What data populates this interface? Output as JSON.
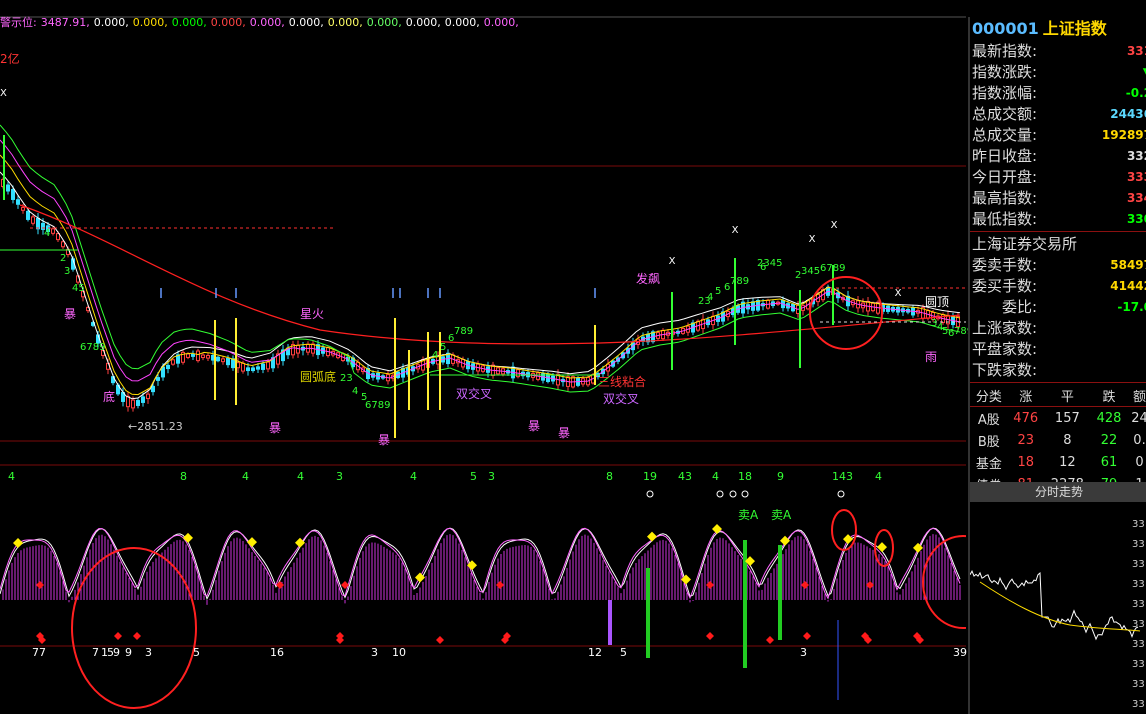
{
  "topbar": {
    "label": "警示位:",
    "values": [
      "3487.91,",
      "0.000,",
      "0.000,",
      "0.000,",
      "0.000,",
      "0.000,",
      "0.000,",
      "0.000,",
      "0.000,",
      "0.000,",
      "0.000,",
      "0.000,"
    ],
    "colors": [
      "#ff66ff",
      "#ffffff",
      "#ffdd00",
      "#00ff00",
      "#ff4444",
      "#ff66ff",
      "#ffffff",
      "#ffff66",
      "#66ff66",
      "#ffffff",
      "#ffffff",
      "#ff66ff"
    ]
  },
  "chart": {
    "left_tag": "2亿",
    "x_marker": "X",
    "low_label": "←2851.23",
    "annotations": {
      "xinghuo": "星火",
      "yuanhudi": "圆弧底",
      "shuangjiaocha1": "双交叉",
      "shuangjiaocha2": "双交叉",
      "sanxian": "三线粘合",
      "fapiao": "发飙",
      "yuanding": "圆顶",
      "yu": "雨",
      "bao1": "暴",
      "bao2": "暴",
      "bao3": "暴",
      "bao4": "暴",
      "bao5": "暴",
      "di": "底",
      "maiA1": "卖A",
      "maiA2": "卖A"
    },
    "seq_labels": [
      "4",
      "2",
      "3",
      "45",
      "6789",
      "23",
      "4",
      "5",
      "6789",
      "4",
      "5",
      "6",
      "789",
      "2345",
      "6",
      "23",
      "4",
      "5",
      "6",
      "789",
      "2",
      "345",
      "6789",
      "3",
      "4",
      "5",
      "6",
      "789"
    ],
    "osc_numbers": [
      "4",
      "8",
      "4",
      "4",
      "3",
      "4",
      "5",
      "3",
      "8",
      "19",
      "43",
      "4",
      "18",
      "9",
      "143",
      "4"
    ],
    "bottom_numbers": [
      "77",
      "7",
      "1",
      "5",
      "9",
      "9",
      "3",
      "5",
      "16",
      "3",
      "10",
      "12",
      "5",
      "3",
      "39"
    ]
  },
  "panel": {
    "code": "000001",
    "name": "上证指数",
    "rows": [
      {
        "label": "最新指数:",
        "value": "331",
        "color": "#ff4444"
      },
      {
        "label": "指数涨跌:",
        "value": "▼",
        "color": "#00ff00"
      },
      {
        "label": "指数涨幅:",
        "value": "-0.2",
        "color": "#00ff00"
      },
      {
        "label": "总成交额:",
        "value": "24436",
        "color": "#5bd8ff"
      },
      {
        "label": "总成交量:",
        "value": "192897",
        "color": "#ffd800"
      },
      {
        "label": "昨日收盘:",
        "value": "332",
        "color": "#dddddd"
      },
      {
        "label": "今日开盘:",
        "value": "333",
        "color": "#ff4444"
      },
      {
        "label": "最高指数:",
        "value": "334",
        "color": "#ff4444"
      },
      {
        "label": "最低指数:",
        "value": "330",
        "color": "#00ff00"
      }
    ],
    "exchange": "上海证券交易所",
    "rows2": [
      {
        "label": "委卖手数:",
        "value": "58497",
        "color": "#ffd800"
      },
      {
        "label": "委买手数:",
        "value": "41442",
        "color": "#ffd800"
      },
      {
        "label": "委比:",
        "value": "-17.0",
        "color": "#00ff00"
      },
      {
        "label": "上涨家数:",
        "value": "",
        "color": "#ff4444"
      },
      {
        "label": "平盘家数:",
        "value": "",
        "color": "#dddddd"
      },
      {
        "label": "下跌家数:",
        "value": "",
        "color": "#00ff00"
      }
    ],
    "table_headers": [
      "分类",
      "涨",
      "平",
      "跌",
      "额"
    ],
    "table_rows": [
      {
        "cat": "A股",
        "up": "476",
        "flat": "157",
        "down": "428",
        "amt": "24"
      },
      {
        "cat": "B股",
        "up": "23",
        "flat": "8",
        "down": "22",
        "amt": "0."
      },
      {
        "cat": "基金",
        "up": "18",
        "flat": "12",
        "down": "61",
        "amt": "0"
      },
      {
        "cat": "债券",
        "up": "81",
        "flat": "2278",
        "down": "79",
        "amt": "1"
      }
    ],
    "tab_label": "分时走势",
    "mini_axis": [
      "33",
      "33",
      "33",
      "33",
      "33",
      "33",
      "33",
      "33",
      "33",
      "33"
    ]
  }
}
